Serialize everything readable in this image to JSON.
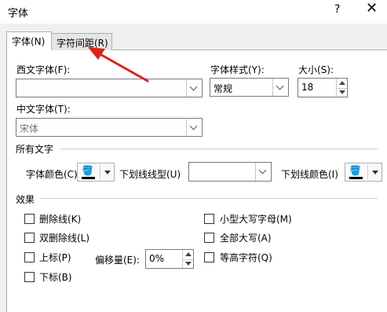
{
  "window": {
    "title": "字体",
    "help": "?",
    "close": "✕"
  },
  "tabs": [
    {
      "label": "字体(N)",
      "active": true
    },
    {
      "label": "字符间距(R)",
      "active": false
    }
  ],
  "western_font": {
    "label": "西文字体(F):",
    "value": ""
  },
  "font_style": {
    "label": "字体样式(Y):",
    "value": "常规"
  },
  "size": {
    "label": "大小(S):",
    "value": "18"
  },
  "chinese_font": {
    "label": "中文字体(T):",
    "value": "宋体"
  },
  "all_text": {
    "section": "所有文字",
    "font_color_label": "字体颜色(C)",
    "underline_style_label": "下划线线型(U)",
    "underline_style_value": "",
    "underline_color_label": "下划线颜色(I)"
  },
  "effects": {
    "section": "效果",
    "items": [
      {
        "label": "删除线(K)",
        "checked": false
      },
      {
        "label": "双删除线(L)",
        "checked": false
      },
      {
        "label": "上标(P)",
        "checked": false
      },
      {
        "label": "下标(B)",
        "checked": false
      },
      {
        "label": "小型大写字母(M)",
        "checked": false
      },
      {
        "label": "全部大写(A)",
        "checked": false
      },
      {
        "label": "等高字符(Q)",
        "checked": false
      }
    ],
    "offset_label": "偏移量(E):",
    "offset_value": "0%"
  },
  "colors": {
    "arrow": "#d9231c",
    "accent": "#000000"
  }
}
